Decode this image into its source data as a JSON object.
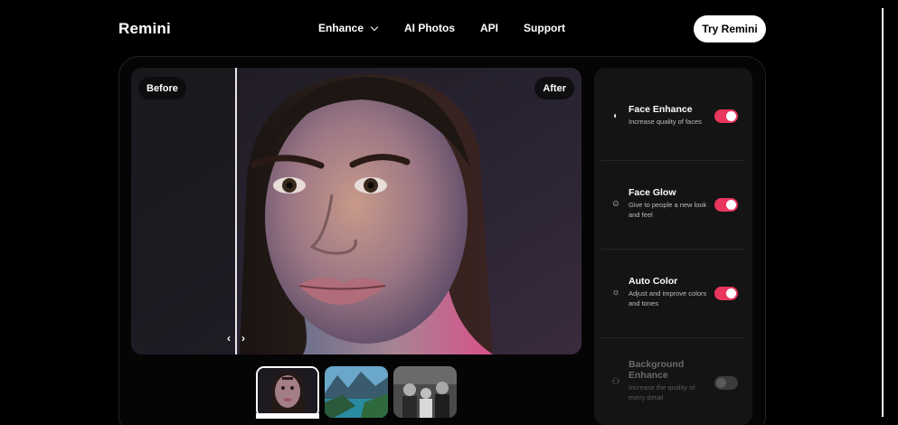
{
  "header": {
    "logo": "Remini",
    "nav": [
      {
        "label": "Enhance"
      },
      {
        "label": "AI Photos"
      },
      {
        "label": "API"
      },
      {
        "label": "Support"
      }
    ],
    "cta": "Try Remini"
  },
  "compare": {
    "before_label": "Before",
    "after_label": "After",
    "handle_left": "‹",
    "handle_right": "›"
  },
  "options": [
    {
      "title": "Face Enhance",
      "desc": "Increase quality of faces",
      "icon": "face-enhance-icon",
      "enabled": true
    },
    {
      "title": "Face Glow",
      "desc": "Give to people a new look and feel",
      "icon": "face-glow-icon",
      "enabled": true
    },
    {
      "title": "Auto Color",
      "desc": "Adjust and improve colors and tones",
      "icon": "sun-icon",
      "enabled": true
    },
    {
      "title": "Background Enhance",
      "desc": "Increase the quality of every detail",
      "icon": "background-icon",
      "enabled": false
    }
  ],
  "colors": {
    "accent": "#e8365d",
    "background": "#000000",
    "panel": "#141414"
  }
}
